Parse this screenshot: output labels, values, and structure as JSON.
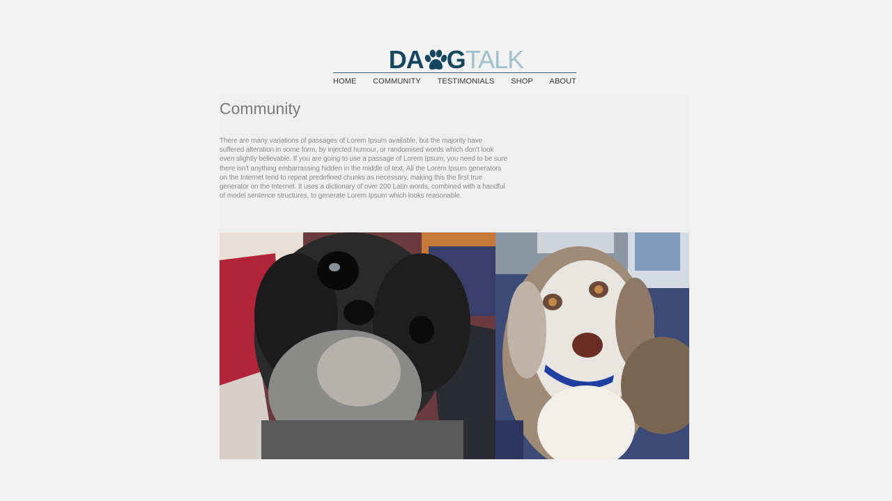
{
  "logo": {
    "part_dark_1": "DA",
    "part_dark_2": "G",
    "part_light": "TALK"
  },
  "nav": {
    "items": [
      "HOME",
      "COMMUNITY",
      "TESTIMONIALS",
      "SHOP",
      "ABOUT"
    ]
  },
  "page": {
    "title": "Community",
    "body": "There are many variations of passages of Lorem Ipsum available, but the majority have suffered alteration in some form, by injected humour, or randomised words which don't look even slightly believable. If you are going to use a passage of Lorem Ipsum, you need to be sure there isn't anything embarrassing hidden in the middle of text. All the Lorem Ipsum generators on the Internet tend to repeat predefined chunks as necessary, making this the first true generator on the Internet. It uses a dictionary of over 200 Latin words, combined with a handful of model sentence structures, to generate Lorem Ipsum which looks reasonable."
  },
  "colors": {
    "background": "#f1f1f1",
    "logo_dark": "#14475f",
    "logo_light": "#9fc0cc"
  },
  "icons": {
    "logo_o": "paw-print-icon"
  }
}
